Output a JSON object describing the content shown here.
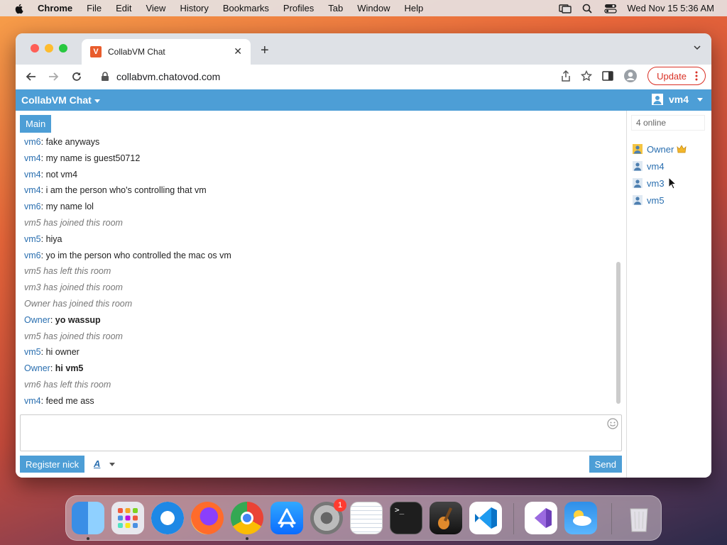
{
  "menubar": {
    "app": "Chrome",
    "items": [
      "File",
      "Edit",
      "View",
      "History",
      "Bookmarks",
      "Profiles",
      "Tab",
      "Window",
      "Help"
    ],
    "clock": "Wed Nov 15  5:36 AM"
  },
  "browser": {
    "tab_title": "CollabVM Chat",
    "url": "collabvm.chatovod.com",
    "update_label": "Update"
  },
  "app": {
    "brand": "CollabVM Chat",
    "current_user": "vm4",
    "room_tab": "Main",
    "messages": [
      {
        "nick": "vm6",
        "sep": ": ",
        "text": "fake anyways",
        "bold": false,
        "system": false
      },
      {
        "nick": "vm4",
        "sep": ": ",
        "text": "my name is guest50712",
        "bold": false,
        "system": false
      },
      {
        "nick": "vm4",
        "sep": ": ",
        "text": "not vm4",
        "bold": false,
        "system": false
      },
      {
        "nick": "vm4",
        "sep": ": ",
        "text": "i am the person who's controlling that vm",
        "bold": false,
        "system": false
      },
      {
        "nick": "vm6",
        "sep": ": ",
        "text": "my name lol",
        "bold": false,
        "system": false
      },
      {
        "nick": "",
        "sep": "",
        "text": "vm5 has joined this room",
        "bold": false,
        "system": true
      },
      {
        "nick": "vm5",
        "sep": ": ",
        "text": "hiya",
        "bold": false,
        "system": false
      },
      {
        "nick": "vm6",
        "sep": ": ",
        "text": "yo im the person who controlled the mac os vm",
        "bold": false,
        "system": false
      },
      {
        "nick": "",
        "sep": "",
        "text": "vm5 has left this room",
        "bold": false,
        "system": true
      },
      {
        "nick": "",
        "sep": "",
        "text": "vm3 has joined this room",
        "bold": false,
        "system": true
      },
      {
        "nick": "",
        "sep": "",
        "text": "Owner has joined this room",
        "bold": false,
        "system": true
      },
      {
        "nick": "Owner",
        "sep": ": ",
        "text": "yo wassup",
        "bold": true,
        "system": false
      },
      {
        "nick": "",
        "sep": "",
        "text": "vm5 has joined this room",
        "bold": false,
        "system": true
      },
      {
        "nick": "vm5",
        "sep": ": ",
        "text": "hi owner",
        "bold": false,
        "system": false
      },
      {
        "nick": "Owner",
        "sep": ": ",
        "text": "hi vm5",
        "bold": true,
        "system": false
      },
      {
        "nick": "",
        "sep": "",
        "text": "vm6 has left this room",
        "bold": false,
        "system": true
      },
      {
        "nick": "vm4",
        "sep": ": ",
        "text": "feed me ass",
        "bold": false,
        "system": false
      }
    ],
    "input_value": "",
    "register_label": "Register nick",
    "format_label": "A",
    "send_label": "Send",
    "online_count": "4 online",
    "users": [
      {
        "name": "Owner",
        "owner": true
      },
      {
        "name": "vm4",
        "owner": false
      },
      {
        "name": "vm3",
        "owner": false
      },
      {
        "name": "vm5",
        "owner": false
      }
    ]
  },
  "dock": {
    "apps": [
      "finder",
      "launchpad",
      "safari",
      "firefox",
      "chrome",
      "app-store",
      "system-settings",
      "textedit",
      "terminal",
      "garageband",
      "vscode",
      "visual-studio",
      "weather",
      "trash"
    ],
    "settings_badge": "1"
  },
  "colors": {
    "accent": "#4d9ed6",
    "nick": "#2a6fb0",
    "update_red": "#d93025"
  }
}
